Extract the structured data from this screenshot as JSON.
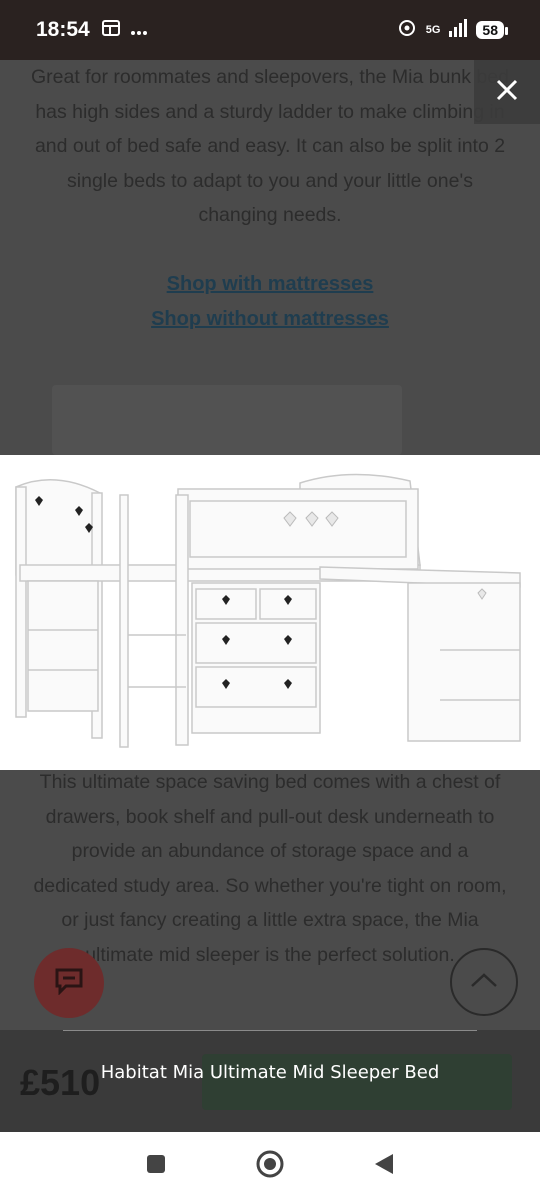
{
  "status_bar": {
    "time": "18:54",
    "network": "5G",
    "battery": "58",
    "icons": [
      "gallery-icon",
      "more-dots-icon",
      "hotspot-icon",
      "signal-icon"
    ]
  },
  "page": {
    "intro_text": "Great for roommates and sleepovers, the Mia bunk bed has high sides and a sturdy ladder to make climbing in and out of bed safe and easy. It can also be split into 2 single beds to adapt to you and your little one's changing needs.",
    "link_with": "Shop with mattresses",
    "link_without": "Shop without mattresses",
    "body_text": "This ultimate space saving bed comes with a chest of drawers, book shelf and pull-out desk underneath to provide an abundance of storage space and a dedicated study area. So whether you're tight on room, or just fancy creating a little extra space, the Mia ultimate mid sleeper is the perfect solution.",
    "price": "£510"
  },
  "viewer": {
    "caption": "Habitat Mia Ultimate Mid Sleeper Bed"
  },
  "colors": {
    "status_bar": "#2a2220",
    "chat_fab": "#6e2c2c",
    "dim_page": "#4b4b4b"
  }
}
